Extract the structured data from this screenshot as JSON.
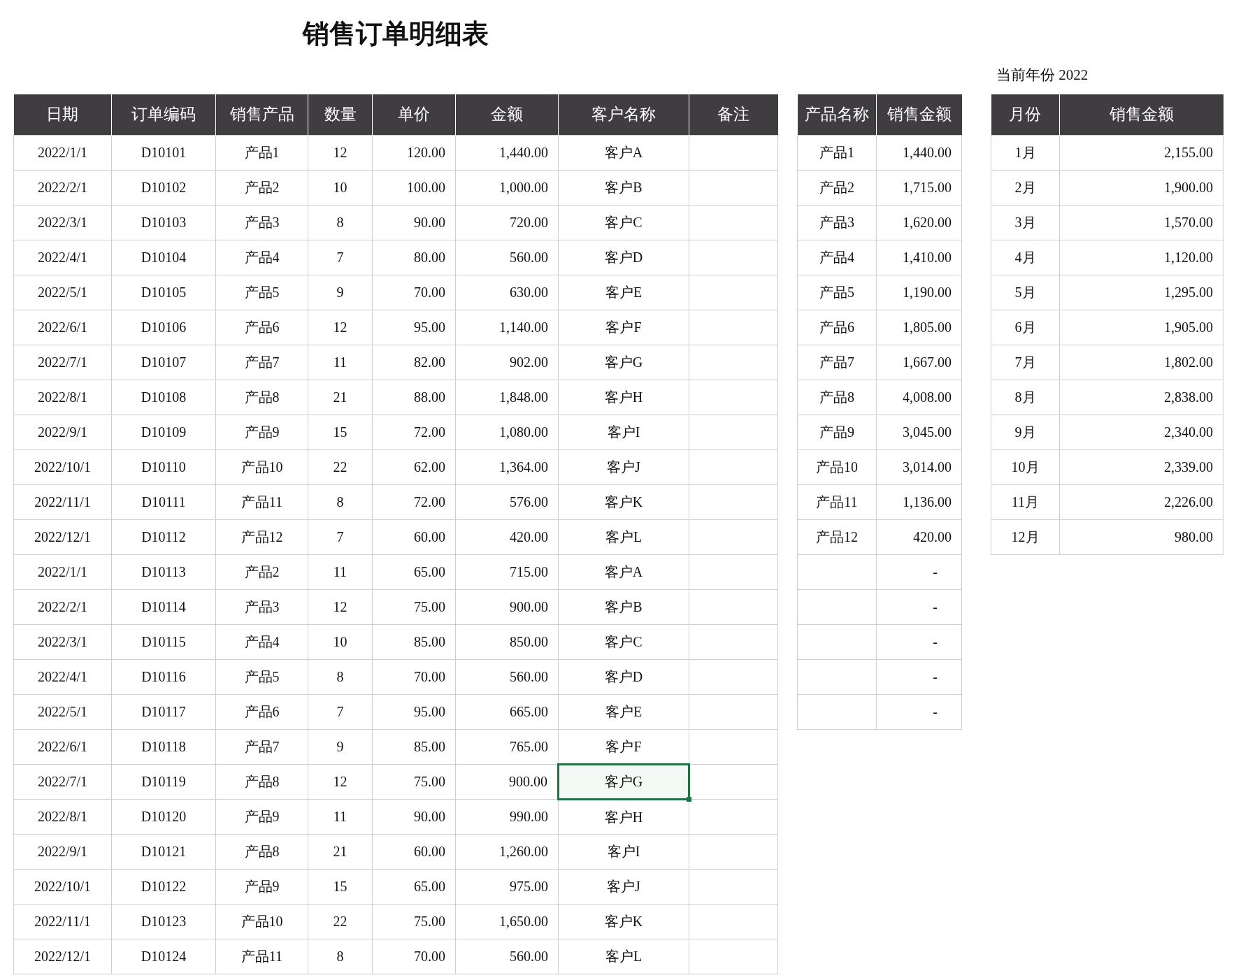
{
  "title": "销售订单明细表",
  "year_label": "当前年份 2022",
  "orders": {
    "columns": [
      "日期",
      "订单编码",
      "销售产品",
      "数量",
      "单价",
      "金额",
      "客户名称",
      "备注"
    ],
    "rows": [
      {
        "cells": [
          "2022/1/1",
          "D10101",
          "产品1",
          "12",
          "120.00",
          "1,440.00",
          "客户A"
        ],
        "customer_selected": false
      },
      {
        "cells": [
          "2022/2/1",
          "D10102",
          "产品2",
          "10",
          "100.00",
          "1,000.00",
          "客户B"
        ],
        "customer_selected": false
      },
      {
        "cells": [
          "2022/3/1",
          "D10103",
          "产品3",
          "8",
          "90.00",
          "720.00",
          "客户C"
        ],
        "customer_selected": false
      },
      {
        "cells": [
          "2022/4/1",
          "D10104",
          "产品4",
          "7",
          "80.00",
          "560.00",
          "客户D"
        ],
        "customer_selected": false
      },
      {
        "cells": [
          "2022/5/1",
          "D10105",
          "产品5",
          "9",
          "70.00",
          "630.00",
          "客户E"
        ],
        "customer_selected": false
      },
      {
        "cells": [
          "2022/6/1",
          "D10106",
          "产品6",
          "12",
          "95.00",
          "1,140.00",
          "客户F"
        ],
        "customer_selected": false
      },
      {
        "cells": [
          "2022/7/1",
          "D10107",
          "产品7",
          "11",
          "82.00",
          "902.00",
          "客户G"
        ],
        "customer_selected": false
      },
      {
        "cells": [
          "2022/8/1",
          "D10108",
          "产品8",
          "21",
          "88.00",
          "1,848.00",
          "客户H"
        ],
        "customer_selected": false
      },
      {
        "cells": [
          "2022/9/1",
          "D10109",
          "产品9",
          "15",
          "72.00",
          "1,080.00",
          "客户I"
        ],
        "customer_selected": false
      },
      {
        "cells": [
          "2022/10/1",
          "D10110",
          "产品10",
          "22",
          "62.00",
          "1,364.00",
          "客户J"
        ],
        "customer_selected": false
      },
      {
        "cells": [
          "2022/11/1",
          "D10111",
          "产品11",
          "8",
          "72.00",
          "576.00",
          "客户K"
        ],
        "customer_selected": false
      },
      {
        "cells": [
          "2022/12/1",
          "D10112",
          "产品12",
          "7",
          "60.00",
          "420.00",
          "客户L"
        ],
        "customer_selected": false
      },
      {
        "cells": [
          "2022/1/1",
          "D10113",
          "产品2",
          "11",
          "65.00",
          "715.00",
          "客户A"
        ],
        "customer_selected": false
      },
      {
        "cells": [
          "2022/2/1",
          "D10114",
          "产品3",
          "12",
          "75.00",
          "900.00",
          "客户B"
        ],
        "customer_selected": false
      },
      {
        "cells": [
          "2022/3/1",
          "D10115",
          "产品4",
          "10",
          "85.00",
          "850.00",
          "客户C"
        ],
        "customer_selected": false
      },
      {
        "cells": [
          "2022/4/1",
          "D10116",
          "产品5",
          "8",
          "70.00",
          "560.00",
          "客户D"
        ],
        "customer_selected": false
      },
      {
        "cells": [
          "2022/5/1",
          "D10117",
          "产品6",
          "7",
          "95.00",
          "665.00",
          "客户E"
        ],
        "customer_selected": false
      },
      {
        "cells": [
          "2022/6/1",
          "D10118",
          "产品7",
          "9",
          "85.00",
          "765.00",
          "客户F"
        ],
        "customer_selected": false
      },
      {
        "cells": [
          "2022/7/1",
          "D10119",
          "产品8",
          "12",
          "75.00",
          "900.00",
          "客户G"
        ],
        "customer_selected": true
      },
      {
        "cells": [
          "2022/8/1",
          "D10120",
          "产品9",
          "11",
          "90.00",
          "990.00",
          "客户H"
        ],
        "customer_selected": false
      },
      {
        "cells": [
          "2022/9/1",
          "D10121",
          "产品8",
          "21",
          "60.00",
          "1,260.00",
          "客户I"
        ],
        "customer_selected": false
      },
      {
        "cells": [
          "2022/10/1",
          "D10122",
          "产品9",
          "15",
          "65.00",
          "975.00",
          "客户J"
        ],
        "customer_selected": false
      },
      {
        "cells": [
          "2022/11/1",
          "D10123",
          "产品10",
          "22",
          "75.00",
          "1,650.00",
          "客户K"
        ],
        "customer_selected": false
      },
      {
        "cells": [
          "2022/12/1",
          "D10124",
          "产品11",
          "8",
          "70.00",
          "560.00",
          "客户L"
        ],
        "customer_selected": false
      }
    ]
  },
  "by_product": {
    "columns": [
      "产品名称",
      "销售金额"
    ],
    "rows": [
      {
        "kind": "value",
        "name": "产品1",
        "amount": "1,440.00"
      },
      {
        "kind": "value",
        "name": "产品2",
        "amount": "1,715.00"
      },
      {
        "kind": "value",
        "name": "产品3",
        "amount": "1,620.00"
      },
      {
        "kind": "value",
        "name": "产品4",
        "amount": "1,410.00"
      },
      {
        "kind": "value",
        "name": "产品5",
        "amount": "1,190.00"
      },
      {
        "kind": "value",
        "name": "产品6",
        "amount": "1,805.00"
      },
      {
        "kind": "value",
        "name": "产品7",
        "amount": "1,667.00"
      },
      {
        "kind": "value",
        "name": "产品8",
        "amount": "4,008.00"
      },
      {
        "kind": "value",
        "name": "产品9",
        "amount": "3,045.00"
      },
      {
        "kind": "value",
        "name": "产品10",
        "amount": "3,014.00"
      },
      {
        "kind": "value",
        "name": "产品11",
        "amount": "1,136.00"
      },
      {
        "kind": "value",
        "name": "产品12",
        "amount": "420.00"
      },
      {
        "kind": "empty",
        "amount": "-"
      },
      {
        "kind": "empty",
        "amount": "-"
      },
      {
        "kind": "empty",
        "amount": "-"
      },
      {
        "kind": "empty",
        "amount": "-"
      },
      {
        "kind": "empty",
        "amount": "-"
      }
    ]
  },
  "by_month": {
    "columns": [
      "月份",
      "销售金额"
    ],
    "rows": [
      {
        "month": "1月",
        "amount": "2,155.00"
      },
      {
        "month": "2月",
        "amount": "1,900.00"
      },
      {
        "month": "3月",
        "amount": "1,570.00"
      },
      {
        "month": "4月",
        "amount": "1,120.00"
      },
      {
        "month": "5月",
        "amount": "1,295.00"
      },
      {
        "month": "6月",
        "amount": "1,905.00"
      },
      {
        "month": "7月",
        "amount": "1,802.00"
      },
      {
        "month": "8月",
        "amount": "2,838.00"
      },
      {
        "month": "9月",
        "amount": "2,340.00"
      },
      {
        "month": "10月",
        "amount": "2,339.00"
      },
      {
        "month": "11月",
        "amount": "2,226.00"
      },
      {
        "month": "12月",
        "amount": "980.00"
      }
    ]
  }
}
